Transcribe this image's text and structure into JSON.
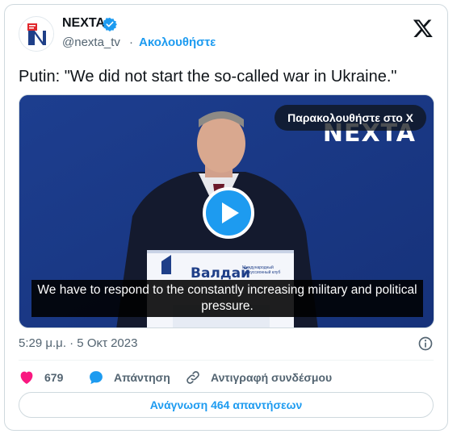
{
  "author": {
    "name": "NEXTA",
    "handle": "@nexta_tv",
    "separator": "·",
    "follow_label": "Ακολουθήστε"
  },
  "tweet": {
    "text": "Putin: \"We did not start the so-called war in Ukraine.\""
  },
  "media": {
    "watch_label": "Παρακολουθήστε στο X",
    "logo_text": "NEXTA",
    "podium_text": "Валдай",
    "podium_subtext": "Международный дискуссионный клуб",
    "subtitle": "We have to respond to the constantly increasing military and political pressure."
  },
  "meta": {
    "timestamp": "5:29 μ.μ. · 5 Οκτ 2023"
  },
  "actions": {
    "like_count": "679",
    "reply_label": "Απάντηση",
    "copy_label": "Αντιγραφή συνδέσμου"
  },
  "footer": {
    "read_replies_label": "Ανάγνωση 464 απαντήσεων"
  },
  "colors": {
    "accent": "#1d9bf0",
    "like": "#f91880",
    "text": "#0f1419",
    "muted": "#536471"
  }
}
